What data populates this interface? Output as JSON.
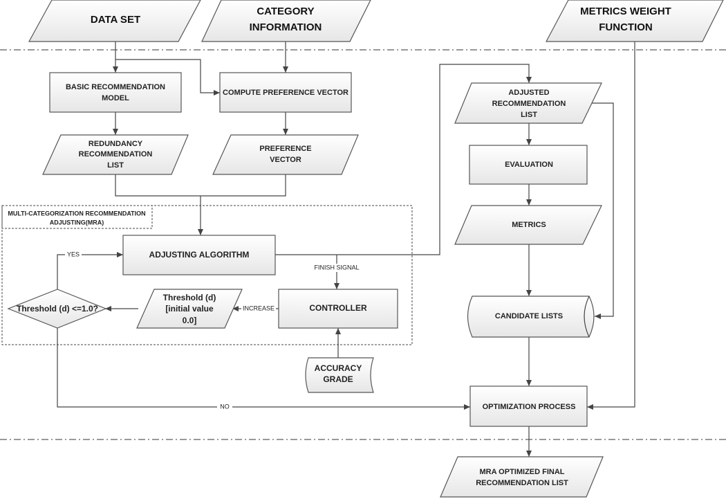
{
  "inputs": {
    "data_set": "DATA SET",
    "category_information": [
      "CATEGORY",
      "INFORMATION"
    ],
    "metrics_weight_function": [
      "METRICS WEIGHT",
      "FUNCTION"
    ]
  },
  "nodes": {
    "basic_model": [
      "BASIC RECOMMENDATION",
      "MODEL"
    ],
    "compute_preference": "COMPUTE PREFERENCE VECTOR",
    "redundancy_list": [
      "REDUNDANCY",
      "RECOMMENDATION",
      "LIST"
    ],
    "preference_vector": [
      "PREFERENCE",
      "VECTOR"
    ],
    "mra_label": [
      "MULTI-CATEGORIZATION RECOMMENDATION",
      "ADJUSTING(MRA)"
    ],
    "adjusting_algorithm": "ADJUSTING ALGORITHM",
    "controller": "CONTROLLER",
    "threshold": [
      "Threshold (d)",
      "[initial value",
      "0.0]"
    ],
    "decision": "Threshold (d) <=1.0?",
    "accuracy_grade": [
      "ACCURACY",
      "GRADE"
    ],
    "adjusted_list": [
      "ADJUSTED",
      "RECOMMENDATION",
      "LIST"
    ],
    "evaluation": "EVALUATION",
    "metrics": "METRICS",
    "candidate_lists": "CANDIDATE LISTS",
    "optimization": "OPTIMIZATION PROCESS",
    "final_list": [
      "MRA OPTIMIZED FINAL",
      "RECOMMENDATION LIST"
    ]
  },
  "edge_labels": {
    "yes": "YES",
    "no": "NO",
    "finish_signal": "FINISH SIGNAL",
    "increase": "INCREASE"
  },
  "colors": {
    "stroke": "#555555",
    "fill_top": "#ffffff",
    "fill_bottom": "#e6e6e6"
  }
}
